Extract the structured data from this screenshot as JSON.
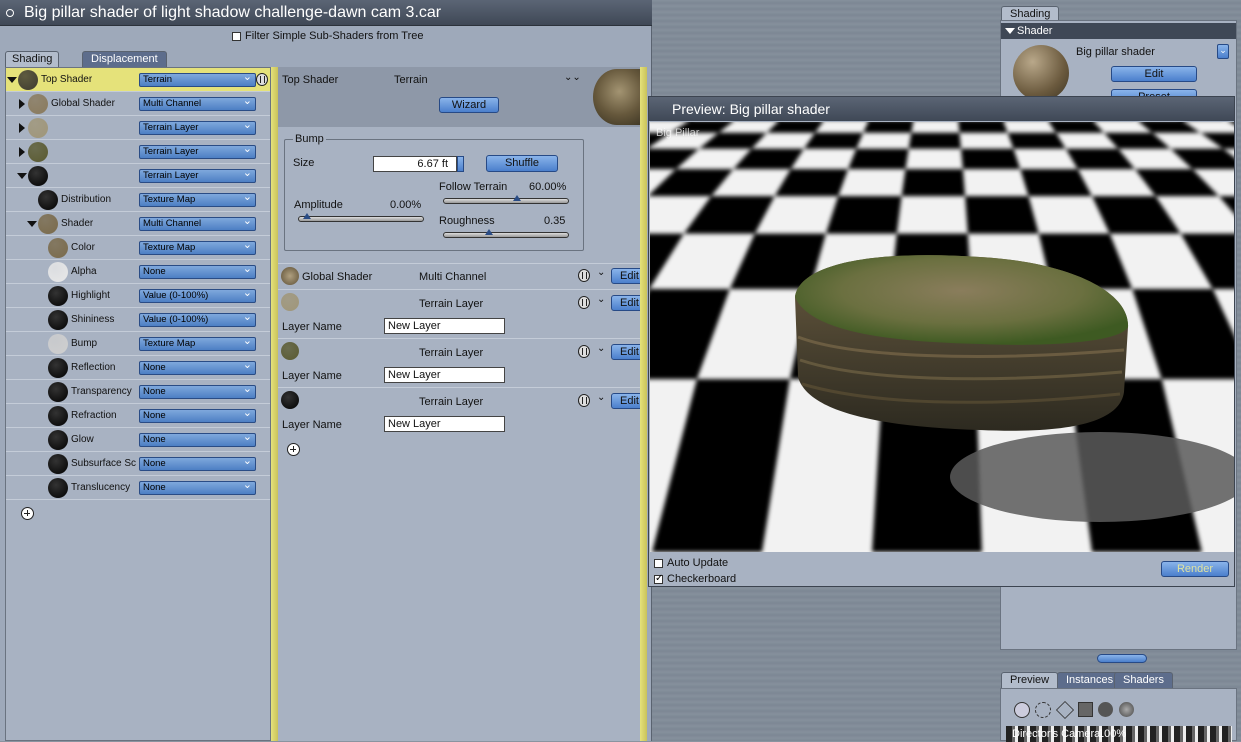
{
  "window": {
    "title": "Big pillar shader of light shadow challenge-dawn cam 3.car"
  },
  "filter": {
    "label": "Filter Simple Sub-Shaders from Tree"
  },
  "tabs": [
    "Shading",
    "Displacement"
  ],
  "tree": {
    "rows": [
      {
        "label": "Top Shader",
        "type": "Terrain"
      },
      {
        "label": "Global Shader",
        "type": "Multi Channel"
      },
      {
        "label": "",
        "type": "Terrain Layer"
      },
      {
        "label": "",
        "type": "Terrain Layer"
      },
      {
        "label": "",
        "type": "Terrain Layer"
      },
      {
        "label": "Distribution",
        "type": "Texture Map"
      },
      {
        "label": "Shader",
        "type": "Multi Channel"
      },
      {
        "label": "Color",
        "type": "Texture Map"
      },
      {
        "label": "Alpha",
        "type": "None"
      },
      {
        "label": "Highlight",
        "type": "Value (0-100%)"
      },
      {
        "label": "Shininess",
        "type": "Value (0-100%)"
      },
      {
        "label": "Bump",
        "type": "Texture Map"
      },
      {
        "label": "Reflection",
        "type": "None"
      },
      {
        "label": "Transparency",
        "type": "None"
      },
      {
        "label": "Refraction",
        "type": "None"
      },
      {
        "label": "Glow",
        "type": "None"
      },
      {
        "label": "Subsurface Sc",
        "type": "None"
      },
      {
        "label": "Translucency",
        "type": "None"
      }
    ]
  },
  "detail": {
    "top_shader_label": "Top Shader",
    "top_shader_type": "Terrain",
    "wizard_label": "Wizard",
    "bump": {
      "title": "Bump",
      "size_label": "Size",
      "size_value": "6.67 ft",
      "shuffle_label": "Shuffle",
      "amplitude_label": "Amplitude",
      "amplitude_value": "0.00%",
      "follow_label": "Follow Terrain",
      "follow_value": "60.00%",
      "roughness_label": "Roughness",
      "roughness_value": "0.35"
    },
    "global_shader_label": "Global Shader",
    "global_shader_type": "Multi Channel",
    "edit_label": "Edit",
    "layers": [
      {
        "type": "Terrain Layer",
        "name_label": "Layer Name",
        "name_value": "New Layer"
      },
      {
        "type": "Terrain Layer",
        "name_label": "Layer Name",
        "name_value": "New Layer"
      },
      {
        "type": "Terrain Layer",
        "name_label": "Layer Name",
        "name_value": "New Layer"
      }
    ]
  },
  "preview": {
    "title": "Preview: Big pillar shader",
    "overlay_text": "Big Pillar",
    "auto_update_label": "Auto Update",
    "checkerboard_label": "Checkerboard",
    "render_label": "Render"
  },
  "right_panel": {
    "tab_label": "Shading",
    "section_label": "Shader",
    "shader_name": "Big pillar shader",
    "edit_label": "Edit",
    "preset_label": "Preset",
    "bottom_tabs": [
      "Preview",
      "Instances",
      "Shaders"
    ],
    "camera_label": "Director's Camera",
    "zoom": "100%"
  }
}
